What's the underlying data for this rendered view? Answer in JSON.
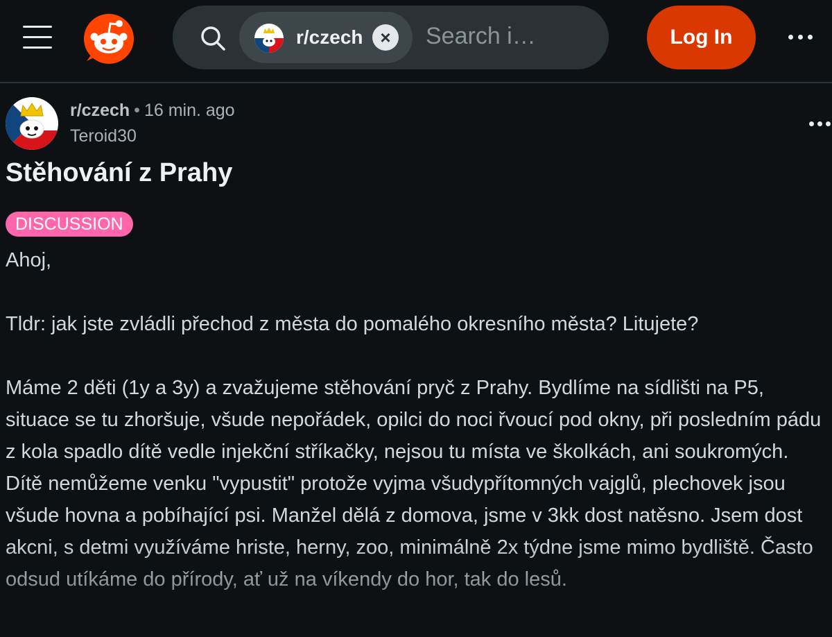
{
  "header": {
    "menu_icon": "hamburger-menu-icon",
    "logo_icon": "reddit-snoo-logo",
    "search": {
      "chip_label": "r/czech",
      "chip_close_glyph": "×",
      "placeholder": "Search i…"
    },
    "login_label": "Log In",
    "more_icon": "horizontal-ellipsis-icon"
  },
  "post": {
    "subreddit": "r/czech",
    "separator": "•",
    "time_ago": "16 min. ago",
    "author": "Teroid30",
    "title": "Stěhování z Prahy",
    "flair": "DISCUSSION",
    "paragraphs": [
      "Ahoj,",
      "Tldr: jak jste zvládli přechod z města do pomalého okresního města? Litujete?",
      "Máme 2 děti (1y a 3y) a zvažujeme stěhování pryč z Prahy. Bydlíme na sídlišti na P5, situace se tu zhoršuje, všude nepořádek, opilci do noci řvoucí pod okny, při posledním pádu z kola spadlo dítě vedle injekční stříkačky, nejsou tu místa ve školkách, ani soukromých. Dítě nemůžeme venku \"vypustit\" protože vyjma všudypřítomných vajglů, plechovek jsou všude hovna a pobíhající psi. Manžel dělá z domova, jsme v 3kk dost natěsno. Jsem dost akcni, s detmi využíváme hriste, herny, zoo, minimálně 2x týdne jsme mimo bydliště. Často odsud utíkáme do přírody, ať už na víkendy do hor, tak do lesů."
    ]
  },
  "colors": {
    "background": "#0e1113",
    "search_bg": "#2a3236",
    "login_bg": "#d93900",
    "flair_bg": "#ff66ac",
    "reddit_orange": "#ff4500"
  }
}
